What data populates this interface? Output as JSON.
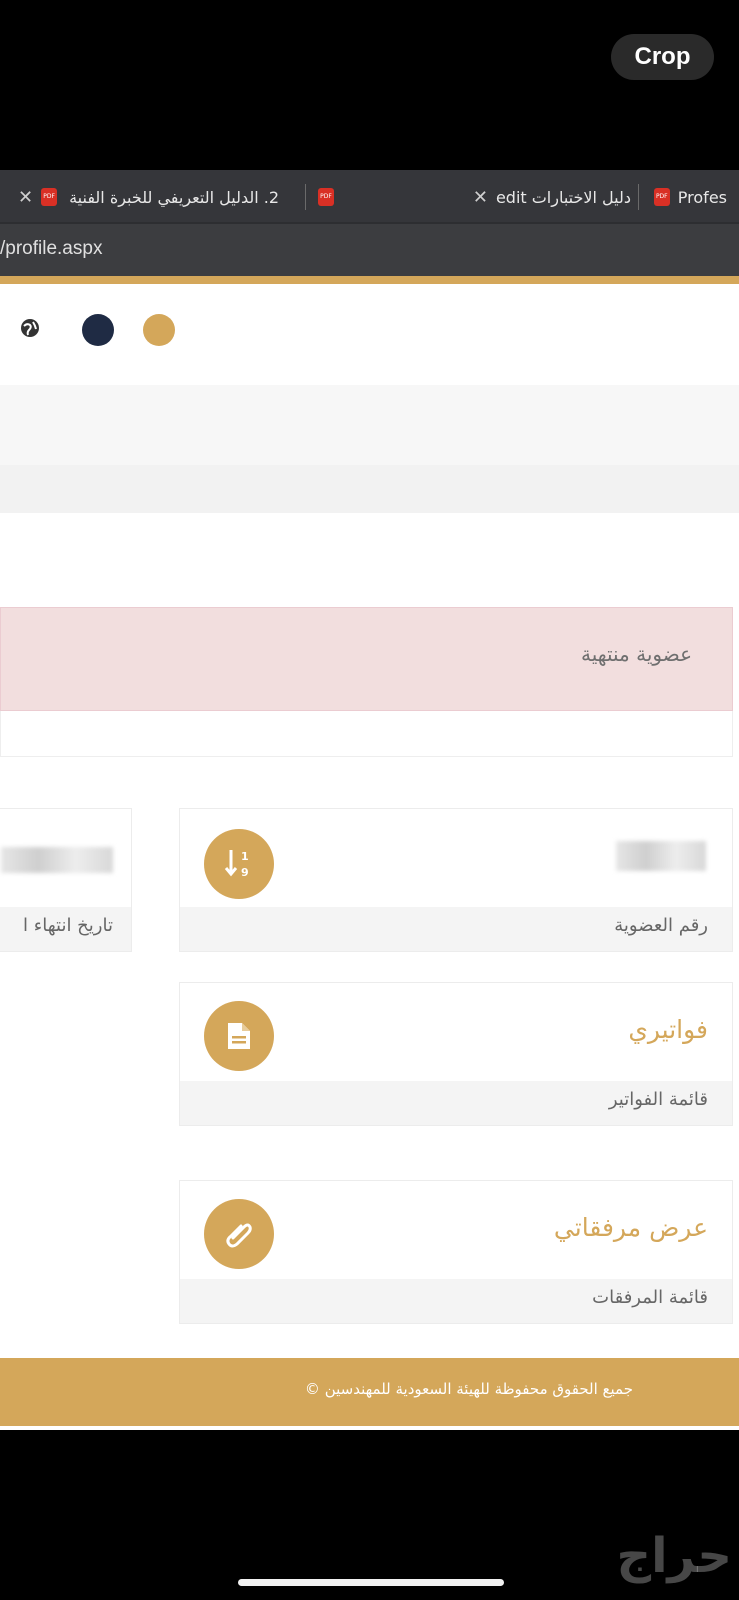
{
  "overlay": {
    "crop_label": "Crop"
  },
  "browser": {
    "tabs": [
      {
        "label": "2. الدليل التعريفي للخبرة الفنية"
      },
      {
        "label": ""
      },
      {
        "label": "دليل الاختبارات edit"
      },
      {
        "label": "Profes"
      }
    ],
    "url": "/profile.aspx"
  },
  "colors": {
    "gold": "#d4a75a",
    "navy": "#1f2b44",
    "alert_bg": "#f2dede"
  },
  "alert": {
    "text": "عضوية منتهية"
  },
  "cards": {
    "membership": {
      "footer": "رقم العضوية",
      "icon": "sort-numeric-icon"
    },
    "expiry": {
      "footer": "تاريخ انتهاء ا"
    },
    "invoices": {
      "title": "فواتيري",
      "footer": "قائمة الفواتير",
      "icon": "file-text-icon"
    },
    "attachments": {
      "title": "عرض مرفقاتي",
      "footer": "قائمة المرفقات",
      "icon": "paperclip-icon"
    }
  },
  "footer": {
    "copyright": "جميع الحقوق محفوظة للهيئة السعودية للمهندسين ©"
  },
  "watermark": "حراج"
}
